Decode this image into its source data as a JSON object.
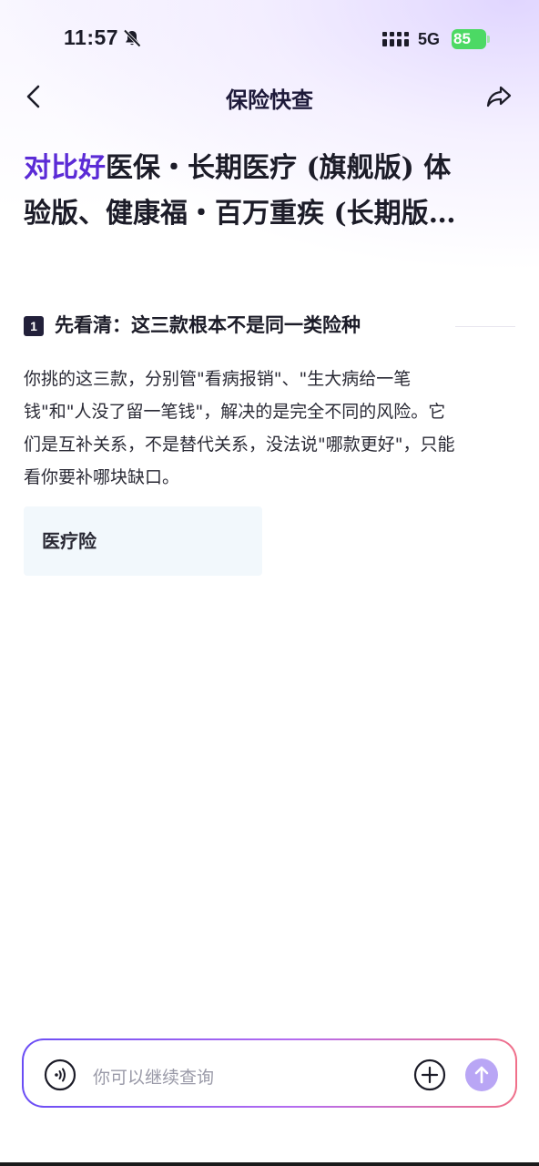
{
  "status_bar": {
    "time": "11:57",
    "network": "5G",
    "battery": "85",
    "battery_color": "#4cd964"
  },
  "nav": {
    "title": "保险快查",
    "back_icon": "chevron-left-icon",
    "share_icon": "share-icon"
  },
  "headline": {
    "accent": "对比好",
    "line1_rest": "医保・长期医疗 (旗舰版) 体",
    "line2": "验版、健康福・百万重疾 (长期版…",
    "accent_color": "#5b2bd6"
  },
  "section1": {
    "number": "1",
    "title": "先看清：这三款根本不是同一类险种"
  },
  "paragraph": {
    "lines": [
      "你挑的这三款，分别管\"看病报销\"、\"生大病给一笔",
      "钱\"和\"人没了留一笔钱\"，解决的是完全不同的风险。它",
      "们是互补关系，不是替代关系，没法说\"哪款更好\"，只能",
      "看你要补哪块缺口。"
    ]
  },
  "card": {
    "title": "医疗险"
  },
  "input_bar": {
    "placeholder": "你可以继续查询",
    "voice_icon": "voice-icon",
    "add_icon": "plus-circle-icon",
    "send_icon": "send-arrow-icon"
  }
}
